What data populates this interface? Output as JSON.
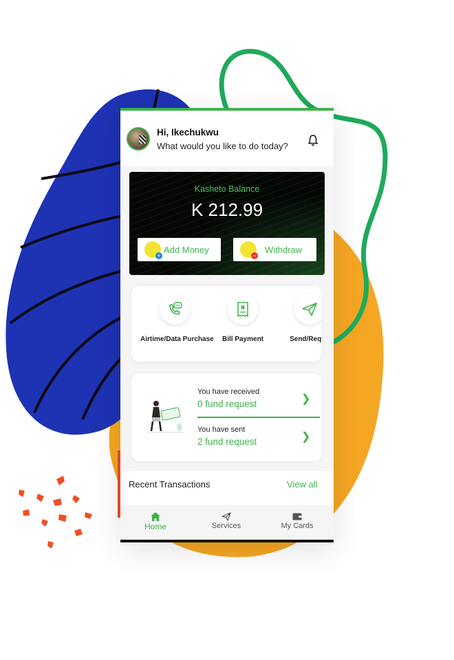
{
  "header": {
    "greeting": "Hi,  Ikechukwu",
    "subtitle": "What would you like to do today?"
  },
  "balance": {
    "label": "Kasheto Balance",
    "amount": "K 212.99",
    "add_money": "Add Money",
    "withdraw": "Withdraw"
  },
  "services": [
    {
      "label": "Airtime/Data Purchase",
      "icon": "phone-chat-icon"
    },
    {
      "label": "Bill Payment",
      "icon": "naira-receipt-icon"
    },
    {
      "label": "Send/Reque",
      "icon": "send-plane-icon"
    }
  ],
  "fund_requests": {
    "received_label": "You have received",
    "received_value": "0 fund request",
    "sent_label": "You have sent",
    "sent_value": "2 fund request"
  },
  "recent": {
    "title": "Recent Transactions",
    "view_all": "View all"
  },
  "nav": {
    "home": "Home",
    "services": "Services",
    "cards": "My Cards"
  },
  "colors": {
    "accent": "#3db34a",
    "blob_blue": "#1e32b4",
    "blob_orange": "#f5a623",
    "splash_red": "#f04e23",
    "coin_yellow": "#f3e52f"
  }
}
